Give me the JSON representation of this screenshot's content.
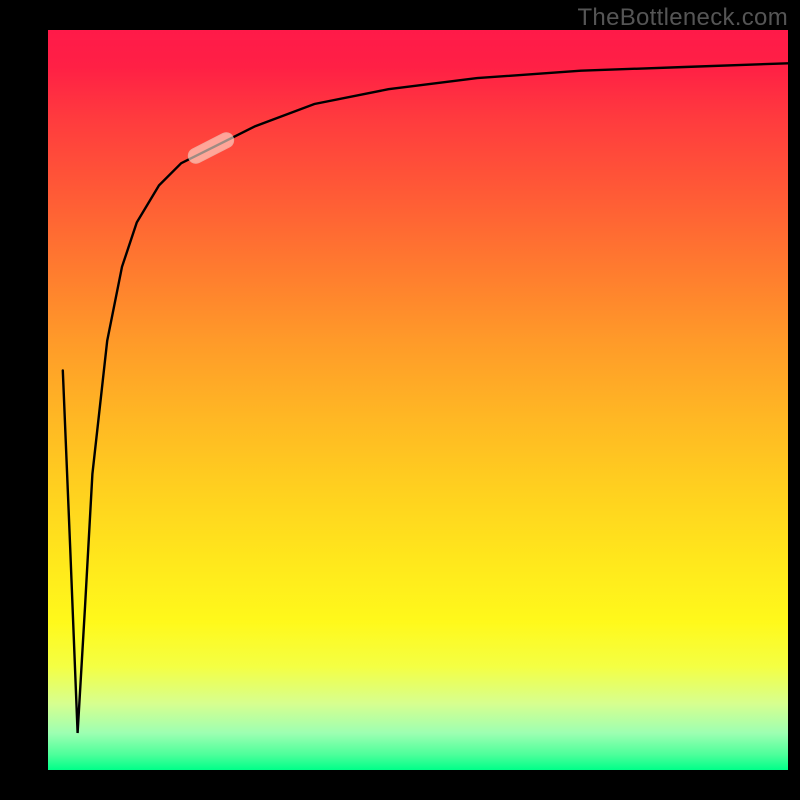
{
  "watermark": "TheBottleneck.com",
  "marker": {
    "x_pct": 22,
    "y_pct": 17
  },
  "chart_data": {
    "type": "line",
    "title": "",
    "xlabel": "",
    "ylabel": "",
    "xlim": [
      0,
      100
    ],
    "ylim": [
      0,
      100
    ],
    "background_gradient": {
      "top": "#ff1a49",
      "mid": "#ffd01f",
      "bottom": "#00ff89"
    },
    "series": [
      {
        "name": "bottleneck-curve",
        "x": [
          2,
          3,
          4,
          5,
          6,
          8,
          10,
          12,
          15,
          18,
          22,
          28,
          36,
          46,
          58,
          72,
          86,
          100
        ],
        "y": [
          54,
          30,
          5,
          22,
          40,
          58,
          68,
          74,
          79,
          82,
          84,
          87,
          90,
          92,
          93.5,
          94.5,
          95,
          95.5
        ]
      }
    ],
    "marker": {
      "x": 22,
      "y": 84
    },
    "grid": false,
    "legend": false
  }
}
